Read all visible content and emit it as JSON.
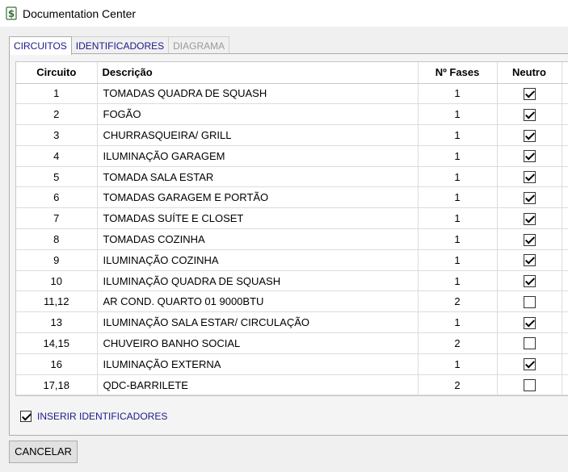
{
  "window": {
    "title": "Documentation Center",
    "icon": "dollar-doc-icon"
  },
  "tabs": [
    {
      "label": "CIRCUITOS",
      "state": "active"
    },
    {
      "label": "IDENTIFICADORES",
      "state": "normal"
    },
    {
      "label": "DIAGRAMA",
      "state": "disabled"
    }
  ],
  "table": {
    "headers": {
      "circuito": "Circuito",
      "descricao": "Descrição",
      "fases": "Nº Fases",
      "neutro": "Neutro"
    },
    "rows": [
      {
        "circuito": "1",
        "descricao": "TOMADAS QUADRA DE SQUASH",
        "fases": "1",
        "neutro": true
      },
      {
        "circuito": "2",
        "descricao": "FOGÃO",
        "fases": "1",
        "neutro": true
      },
      {
        "circuito": "3",
        "descricao": "CHURRASQUEIRA/ GRILL",
        "fases": "1",
        "neutro": true
      },
      {
        "circuito": "4",
        "descricao": "ILUMINAÇÃO GARAGEM",
        "fases": "1",
        "neutro": true
      },
      {
        "circuito": "5",
        "descricao": "TOMADA SALA ESTAR",
        "fases": "1",
        "neutro": true
      },
      {
        "circuito": "6",
        "descricao": "TOMADAS GARAGEM E PORTÃO",
        "fases": "1",
        "neutro": true
      },
      {
        "circuito": "7",
        "descricao": "TOMADAS SUÍTE E CLOSET",
        "fases": "1",
        "neutro": true
      },
      {
        "circuito": "8",
        "descricao": "TOMADAS COZINHA",
        "fases": "1",
        "neutro": true
      },
      {
        "circuito": "9",
        "descricao": "ILUMINAÇÃO COZINHA",
        "fases": "1",
        "neutro": true
      },
      {
        "circuito": "10",
        "descricao": "ILUMINAÇÃO QUADRA DE SQUASH",
        "fases": "1",
        "neutro": true
      },
      {
        "circuito": "11,12",
        "descricao": "AR COND. QUARTO 01 9000BTU",
        "fases": "2",
        "neutro": false
      },
      {
        "circuito": "13",
        "descricao": "ILUMINAÇÃO SALA ESTAR/ CIRCULAÇÃO",
        "fases": "1",
        "neutro": true
      },
      {
        "circuito": "14,15",
        "descricao": "CHUVEIRO BANHO SOCIAL",
        "fases": "2",
        "neutro": false
      },
      {
        "circuito": "16",
        "descricao": "ILUMINAÇÃO EXTERNA",
        "fases": "1",
        "neutro": true
      },
      {
        "circuito": "17,18",
        "descricao": "QDC-BARRILETE",
        "fases": "2",
        "neutro": false
      }
    ]
  },
  "options": {
    "insert_identifiers_label": "INSERIR IDENTIFICADORES",
    "insert_identifiers_checked": true
  },
  "buttons": {
    "cancel_label": "CANCELAR"
  }
}
